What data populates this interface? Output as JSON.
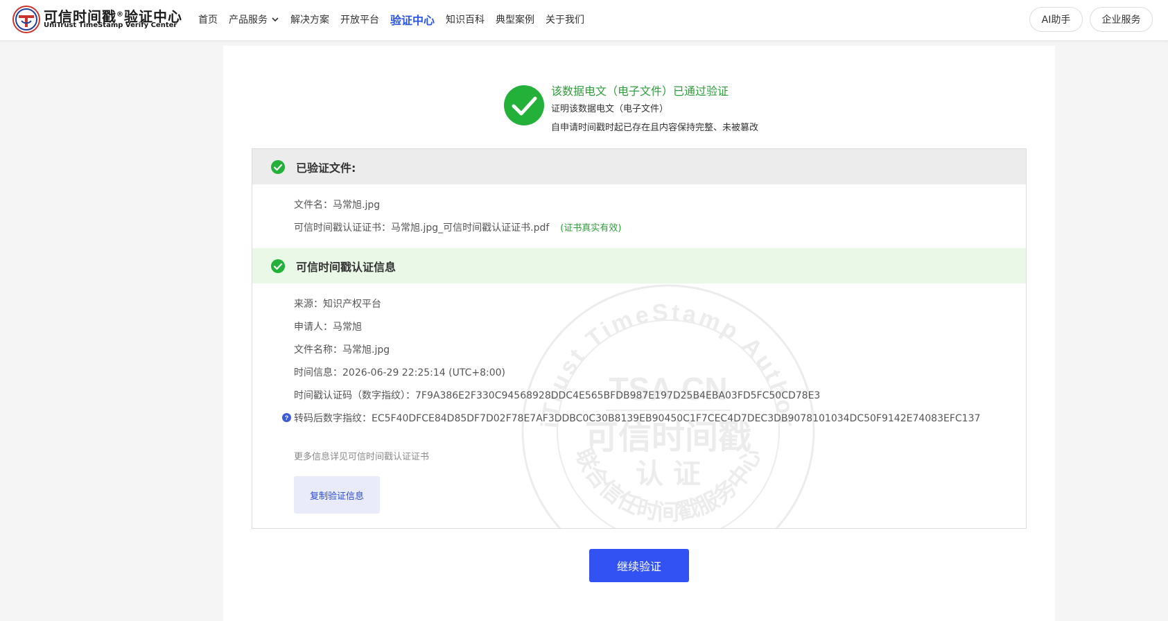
{
  "header": {
    "brand_cn": "可信时间戳",
    "brand_reg": "®",
    "brand_cn2": "验证中心",
    "brand_en": "UniTrust TimeStamp Verify Center",
    "nav": [
      {
        "label": "首页"
      },
      {
        "label": "产品服务"
      },
      {
        "label": "解决方案"
      },
      {
        "label": "开放平台"
      },
      {
        "label": "验证中心"
      },
      {
        "label": "知识百科"
      },
      {
        "label": "典型案例"
      },
      {
        "label": "关于我们"
      }
    ],
    "active_nav": "验证中心",
    "ai_button": "AI助手",
    "business_button": "企业服务"
  },
  "result": {
    "title": "该数据电文（电子文件）已通过验证",
    "line1": "证明该数据电文（电子文件）",
    "line2": "自申请时间戳时起已存在且内容保持完整、未被篡改"
  },
  "verified_file": {
    "section_title": "已验证文件:",
    "filename_label": "文件名：",
    "filename": "马常旭.jpg",
    "cert_label": "可信时间戳认证证书：",
    "cert_file": "马常旭.jpg_可信时间戳认证证书.pdf",
    "cert_status": "(证书真实有效)"
  },
  "auth_info": {
    "section_title": "可信时间戳认证信息",
    "source_label": "来源：",
    "source": "知识产权平台",
    "applicant_label": "申请人：",
    "applicant": "马常旭",
    "filename_label": "文件名称：",
    "filename": "马常旭.jpg",
    "time_label": "时间信息：",
    "time": "2026-06-29 22:25:14 (UTC+8:00)",
    "code_label": "时间戳认证码（数字指纹）：",
    "code": "7F9A386E2F330C94568928DDC4E565BFDB987E197D25B4EBA03FD5FC50CD78E3",
    "converted_label": "转码后数字指纹：",
    "converted": "EC5F40DFCE84D85DF7D02F78E7AF3DDBC0C30B8139EB90450C1F7CEC4D7DEC3DB9078101034DC50F9142E74083EFC137",
    "more_note": "更多信息详见可信时间戳认证证书",
    "copy_button": "复制验证信息"
  },
  "continue_button": "继续验证",
  "watermark": {
    "arc_top": "UniTrust TimeStamp Authority",
    "center": "TSA.CN",
    "cn": "可信时间戳",
    "cn2": "认 证",
    "arc_bottom": "联合信任时间戳服务中心"
  },
  "colors": {
    "accent": "#2a55e5",
    "success": "#2e9d3b",
    "primary_button": "#3352f4"
  }
}
